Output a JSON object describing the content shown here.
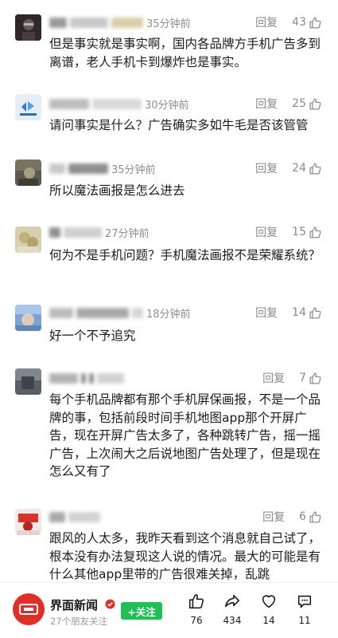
{
  "comments": [
    {
      "time": "35分钟前",
      "reply": "回复",
      "likes": "43",
      "text": "但是事实就是事实啊，国内各品牌方手机广告多到离谱，老人手机卡到爆炸也是事实。"
    },
    {
      "time": "30分钟前",
      "reply": "回复",
      "likes": "25",
      "text": "请问事实是什么？广告确实多如牛毛是否该管管"
    },
    {
      "time": "35分钟前",
      "reply": "回复",
      "likes": "24",
      "text": "所以魔法画报是怎么进去"
    },
    {
      "time": "27分钟前",
      "reply": "回复",
      "likes": "15",
      "text": "何为不是手机问题？手机魔法画报不是荣耀系统？"
    },
    {
      "time": "18分钟前",
      "reply": "回复",
      "likes": "14",
      "text": "好一个不予追究"
    },
    {
      "time": "",
      "reply": "回复",
      "likes": "7",
      "text": "每个手机品牌都有那个手机屏保画报，不是一个品牌的事，包括前段时间手机地图app那个开屏广告，现在开屏广告太多了，各种跳转广告，摇一摇广告，上次闹大之后说地图广告处理了，但是现在怎么又有了"
    },
    {
      "time": "",
      "reply": "回复",
      "likes": "6",
      "text": "跟风的人太多，我昨天看到这个消息就自己试了，根本没有办法复现这人说的情况。最大的可能是有什么其他app里带的广告很难关掉，乱跳"
    }
  ],
  "bottom": {
    "account_name": "界面新闻",
    "friends_following": "27个朋友关注",
    "follow_label": "+关注",
    "like_count": "76",
    "share_count": "434",
    "favorite_count": "14",
    "comment_count": "11"
  },
  "colors": {
    "accent_green": "#1fbf55",
    "brand_red": "#e12f25",
    "meta_gray": "#8e8e8e"
  },
  "icons": [
    "thumbs-up-icon",
    "share-icon",
    "heart-icon",
    "comment-icon",
    "verified-icon"
  ]
}
